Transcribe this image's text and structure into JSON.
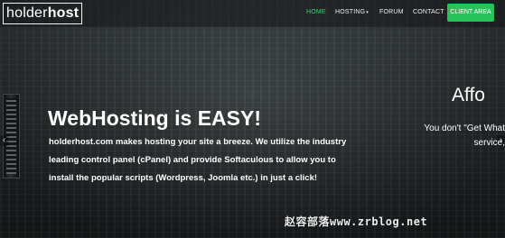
{
  "brand": {
    "logo_part1": "holder",
    "logo_part2": "host"
  },
  "nav": {
    "items": [
      {
        "label": "HOME",
        "active": true
      },
      {
        "label": "HOSTING",
        "dropdown": true
      },
      {
        "label": "FORUM"
      },
      {
        "label": "CONTACT"
      }
    ],
    "cta_label": "CLIENT AREA",
    "active_color": "#3ccf6e",
    "cta_color": "#27c25a"
  },
  "slider": {
    "current": {
      "title": "WebHosting is EASY!",
      "text": "holderhost.com makes hosting your site a breeze. We utilize the industry leading control panel (cPanel) and provide Softaculous to allow you to install the popular scripts (Wordpress, Joomla etc.) in just a click!"
    },
    "next": {
      "title": "Affo",
      "text_line1": "You don't \"Get What",
      "text_line2": "service,"
    },
    "prev_icon": "chevron-left-icon",
    "next_icon": "chevron-right-icon"
  },
  "watermark": "赵容部落www.zrblog.net"
}
